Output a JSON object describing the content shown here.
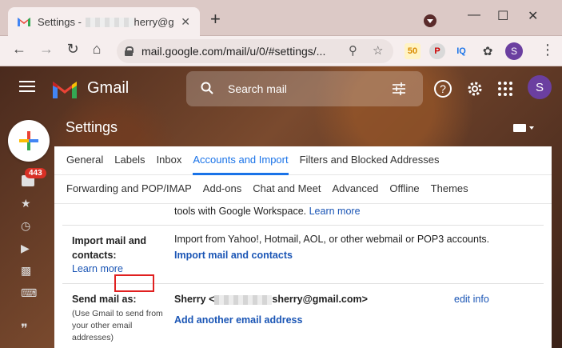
{
  "browser": {
    "tab_title_prefix": "Settings - ",
    "tab_title_suffix": "herry@g",
    "url": "mail.google.com/mail/u/0/#settings/...",
    "profile_initial": "S",
    "ext_iq": "IQ"
  },
  "gmail": {
    "logo_text": "Gmail",
    "search_placeholder": "Search mail",
    "avatar_initial": "S",
    "unread_badge": "443",
    "settings_title": "Settings"
  },
  "settings_tabs_row1": [
    {
      "label": "General"
    },
    {
      "label": "Labels"
    },
    {
      "label": "Inbox"
    },
    {
      "label": "Accounts and Import",
      "active": true
    },
    {
      "label": "Filters and Blocked Addresses"
    }
  ],
  "settings_tabs_row2": [
    {
      "label": "Forwarding and POP/IMAP"
    },
    {
      "label": "Add-ons"
    },
    {
      "label": "Chat and Meet"
    },
    {
      "label": "Advanced"
    },
    {
      "label": "Offline"
    },
    {
      "label": "Themes"
    }
  ],
  "workspace_row": {
    "text": "tools with Google Workspace.",
    "link": "Learn more"
  },
  "import_row": {
    "label": "Import mail and contacts:",
    "learn_more": "Learn more",
    "description": "Import from Yahoo!, Hotmail, AOL, or other webmail or POP3 accounts.",
    "action": "Import mail and contacts"
  },
  "send_as_row": {
    "label": "Send mail as:",
    "help": "(Use Gmail to send from your other email addresses)",
    "name": "Sherry",
    "email_prefix": " <",
    "email_suffix": "sherry@gmail.com>",
    "edit": "edit info",
    "add": "Add another email address"
  }
}
